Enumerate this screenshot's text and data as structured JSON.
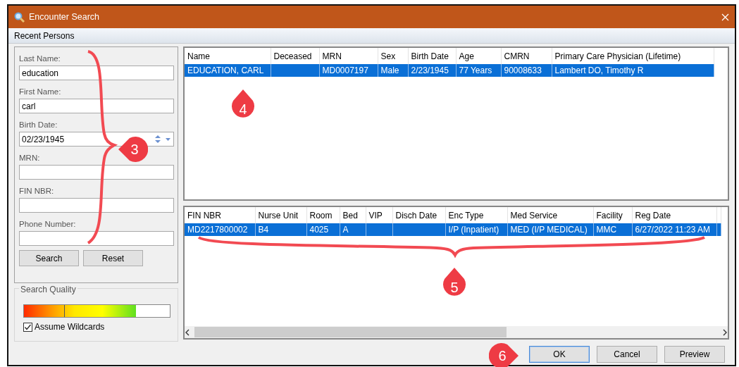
{
  "window": {
    "title": "Encounter Search"
  },
  "menu": [
    {
      "label": "Recent Persons"
    }
  ],
  "search_form": {
    "fields": [
      {
        "label": "Last Name:",
        "value": "education",
        "kind": "text"
      },
      {
        "label": "First Name:",
        "value": "carl",
        "kind": "text"
      },
      {
        "label": "Birth Date:",
        "value": "02/23/1945",
        "kind": "date"
      },
      {
        "label": "MRN:",
        "kind": "text"
      },
      {
        "label": "FIN NBR:",
        "kind": "text"
      },
      {
        "label": "Phone Number:",
        "kind": "text"
      }
    ],
    "buttons": [
      "Search",
      "Reset"
    ]
  },
  "search_quality": {
    "title": "Search Quality",
    "level": 0.77,
    "assume_wildcards": {
      "label": "Assume Wildcards",
      "checked": true
    }
  },
  "persons": {
    "columns": [
      "Name",
      "Deceased",
      "MRN",
      "Sex",
      "Birth Date",
      "Age",
      "CMRN",
      "Primary Care Physician (Lifetime)"
    ],
    "rows": [
      {
        "selected": true,
        "cells": [
          "EDUCATION, CARL",
          "",
          "MD0007197",
          "Male",
          "2/23/1945",
          "77 Years",
          "90008633",
          "Lambert DO, Timothy R"
        ]
      }
    ]
  },
  "encounters": {
    "columns": [
      "FIN NBR",
      "Nurse Unit",
      "Room",
      "Bed",
      "VIP",
      "Disch Date",
      "Enc Type",
      "Med Service",
      "Facility",
      "Reg Date"
    ],
    "rows": [
      {
        "selected": true,
        "cells": [
          "MD2217800002",
          "B4",
          "4025",
          "A",
          "",
          "",
          "I/P (Inpatient)",
          "MED (I/P MEDICAL)",
          "MMC",
          "6/27/2022 11:23 AM"
        ]
      }
    ]
  },
  "footer_buttons": [
    {
      "label": "OK",
      "default": true
    },
    {
      "label": "Cancel",
      "default": false
    },
    {
      "label": "Preview",
      "default": false
    }
  ],
  "annotations": [
    {
      "kind": "callout",
      "number": "3"
    },
    {
      "kind": "callout",
      "number": "4"
    },
    {
      "kind": "callout",
      "number": "5"
    },
    {
      "kind": "callout",
      "number": "6"
    }
  ]
}
